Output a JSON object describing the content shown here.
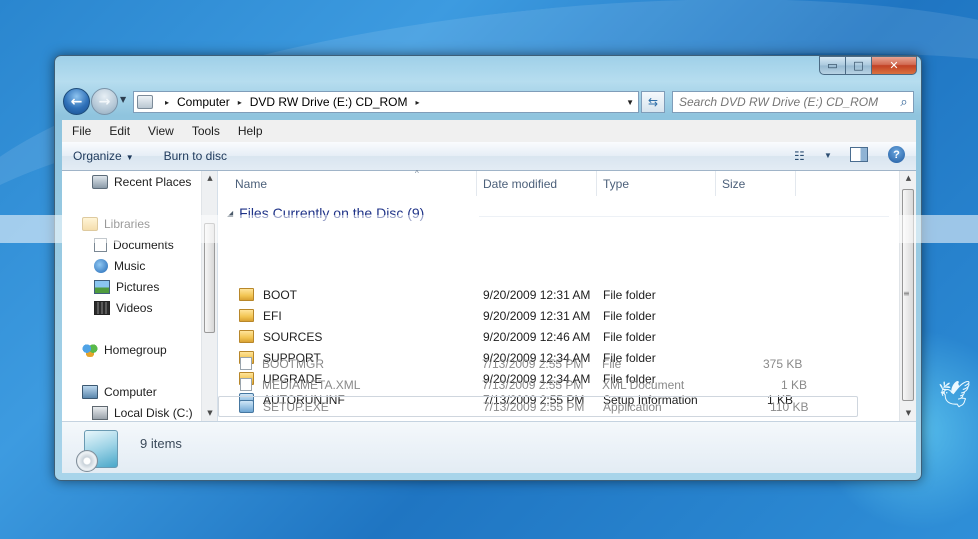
{
  "window": {
    "caption": {
      "minimize": "▭",
      "maximize": "□",
      "close": "✕"
    }
  },
  "address_bar": {
    "crumbs": [
      "Computer",
      "DVD RW Drive (E:) CD_ROM"
    ],
    "separator": "▸"
  },
  "search": {
    "placeholder": "Search DVD RW Drive (E:) CD_ROM"
  },
  "menu": [
    "File",
    "Edit",
    "View",
    "Tools",
    "Help"
  ],
  "toolbar": {
    "organize": "Organize",
    "burn": "Burn to disc"
  },
  "nav_pane": {
    "items": [
      {
        "label": "Recent Places",
        "icon": "recent-places-icon"
      },
      {
        "label": "Libraries",
        "icon": "libraries-icon"
      },
      {
        "label": "Documents",
        "icon": "documents-icon"
      },
      {
        "label": "Music",
        "icon": "music-icon"
      },
      {
        "label": "Pictures",
        "icon": "pictures-icon"
      },
      {
        "label": "Videos",
        "icon": "videos-icon"
      },
      {
        "label": "Homegroup",
        "icon": "homegroup-icon"
      },
      {
        "label": "Computer",
        "icon": "computer-icon"
      },
      {
        "label": "Local Disk (C:)",
        "icon": "local-disk-icon"
      }
    ]
  },
  "columns": [
    "Name",
    "Date modified",
    "Type",
    "Size"
  ],
  "group": {
    "title": "Files Currently on the Disc (9)"
  },
  "files": [
    {
      "name": "BOOT",
      "date": "9/20/2009 12:31 AM",
      "type": "File folder",
      "size": "",
      "icon": "folder-icon"
    },
    {
      "name": "EFI",
      "date": "9/20/2009 12:31 AM",
      "type": "File folder",
      "size": "",
      "icon": "folder-icon"
    },
    {
      "name": "SOURCES",
      "date": "9/20/2009 12:46 AM",
      "type": "File folder",
      "size": "",
      "icon": "folder-icon"
    },
    {
      "name": "SUPPORT",
      "date": "9/20/2009 12:34 AM",
      "type": "File folder",
      "size": "",
      "icon": "folder-icon"
    },
    {
      "name": "UPGRADE",
      "date": "9/20/2009 12:34 AM",
      "type": "File folder",
      "size": "",
      "icon": "folder-icon"
    },
    {
      "name": "AUTORUN.INF",
      "date": "7/13/2009 2:55 PM",
      "type": "Setup Information",
      "size": "1 KB",
      "icon": "setup-information-icon"
    },
    {
      "name": "BOOTMGR",
      "date": "7/13/2009 2:55 PM",
      "type": "File",
      "size": "375 KB",
      "icon": "file-icon"
    },
    {
      "name": "MEDIAMETA.XML",
      "date": "7/13/2009 2:55 PM",
      "type": "XML Document",
      "size": "1 KB",
      "icon": "file-icon"
    },
    {
      "name": "SETUP.EXE",
      "date": "7/13/2009 2:55 PM",
      "type": "Application",
      "size": "110 KB",
      "icon": "setup-exe-icon"
    }
  ],
  "status": {
    "count": "9 items"
  }
}
